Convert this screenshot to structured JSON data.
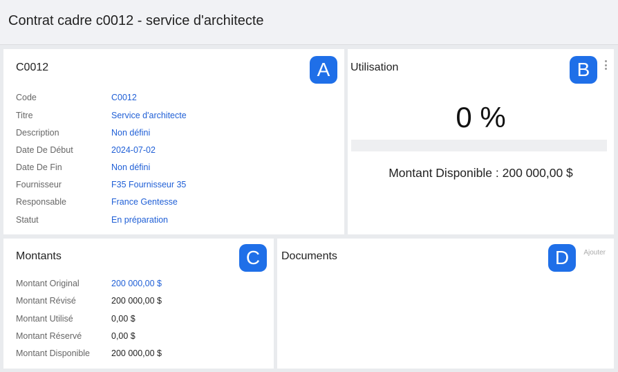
{
  "header": {
    "title": "Contrat cadre c0012 - service d'architecte"
  },
  "info": {
    "title": "C0012",
    "badge": "A",
    "rows": [
      {
        "label": "Code",
        "value": "C0012"
      },
      {
        "label": "Titre",
        "value": "Service d'architecte"
      },
      {
        "label": "Description",
        "value": "Non défini"
      },
      {
        "label": "Date De Début",
        "value": "2024-07-02"
      },
      {
        "label": "Date De Fin",
        "value": "Non défini"
      },
      {
        "label": "Fournisseur",
        "value": "F35 Fournisseur 35"
      },
      {
        "label": "Responsable",
        "value": "France Gentesse"
      },
      {
        "label": "Statut",
        "value": "En préparation"
      }
    ]
  },
  "usage": {
    "title": "Utilisation",
    "badge": "B",
    "percent_label": "0 %",
    "progress": 0,
    "available_label": "Montant Disponible : 200 000,00 $",
    "menu_icon": "kebab-menu-icon"
  },
  "amounts": {
    "title": "Montants",
    "badge": "C",
    "rows": [
      {
        "label": "Montant Original",
        "value": "200 000,00 $"
      },
      {
        "label": "Montant Révisé",
        "value": "200 000,00 $"
      },
      {
        "label": "Montant Utilisé",
        "value": "0,00 $"
      },
      {
        "label": "Montant Réservé",
        "value": "0,00 $"
      },
      {
        "label": "Montant Disponible",
        "value": "200 000,00 $"
      }
    ]
  },
  "documents": {
    "title": "Documents",
    "badge": "D",
    "add_label": "Ajouter"
  },
  "colors": {
    "accent": "#1f6fe8",
    "link": "#1f5fd6",
    "background": "#e9ebee"
  }
}
